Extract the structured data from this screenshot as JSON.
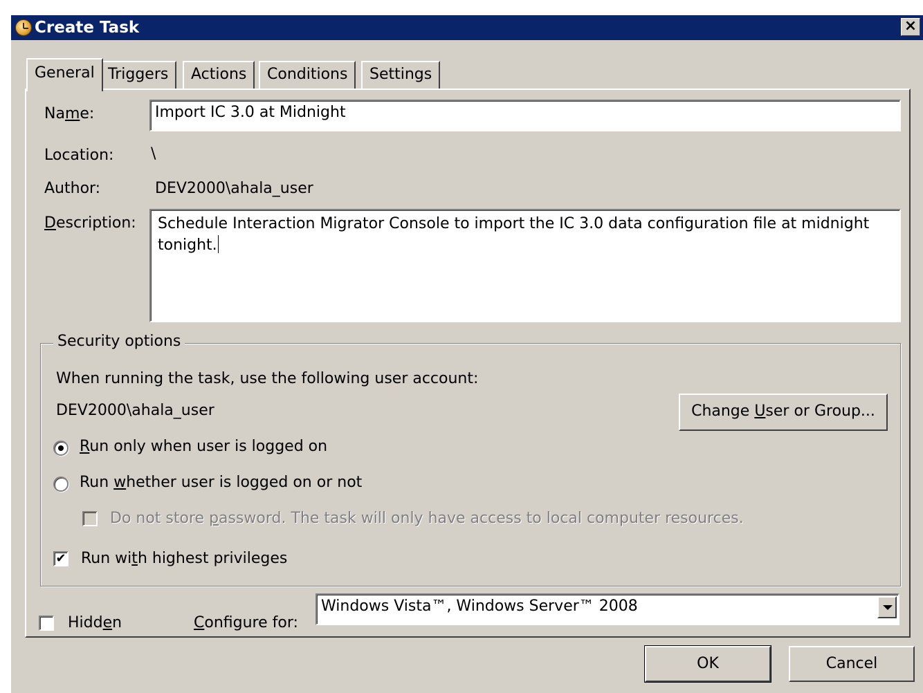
{
  "window": {
    "title": "Create Task",
    "close_glyph": "×"
  },
  "tabs": [
    {
      "label": "General",
      "active": true
    },
    {
      "label": "Triggers",
      "active": false
    },
    {
      "label": "Actions",
      "active": false
    },
    {
      "label": "Conditions",
      "active": false
    },
    {
      "label": "Settings",
      "active": false
    }
  ],
  "general": {
    "name_label_pre": "Na",
    "name_label_u": "m",
    "name_label_post": "e:",
    "name_value": "Import IC 3.0 at Midnight",
    "location_label": "Location:",
    "location_value": "\\",
    "author_label": "Author:",
    "author_value": "DEV2000\\ahala_user",
    "description_label_u": "D",
    "description_label_post": "escription:",
    "description_value": "Schedule Interaction Migrator Console to import the IC 3.0 data configuration file at midnight tonight."
  },
  "security": {
    "legend": "Security options",
    "account_prompt": "When running the task, use the following user account:",
    "account_value": "DEV2000\\ahala_user",
    "change_button_pre": "Change ",
    "change_button_u": "U",
    "change_button_post": "ser or Group...",
    "run_logged_on_u": "R",
    "run_logged_on_post": "un only when user is logged on",
    "run_logged_on_checked": true,
    "run_whether_pre": "Run ",
    "run_whether_u": "w",
    "run_whether_post": "hether user is logged on or not",
    "run_whether_checked": false,
    "no_store_pre": "Do not store ",
    "no_store_u": "p",
    "no_store_post": "assword.  The task will only have access to local computer resources.",
    "no_store_checked": false,
    "highest_pre": "Run wi",
    "highest_u": "t",
    "highest_post": "h highest privileges",
    "highest_checked": true
  },
  "bottom": {
    "hidden_pre": "Hidd",
    "hidden_u": "e",
    "hidden_post": "n",
    "hidden_checked": false,
    "configure_u": "C",
    "configure_post": "onfigure for:",
    "configure_value": "Windows Vista™, Windows Server™ 2008"
  },
  "buttons": {
    "ok": "OK",
    "cancel": "Cancel"
  },
  "checkmark_glyph": "✔"
}
